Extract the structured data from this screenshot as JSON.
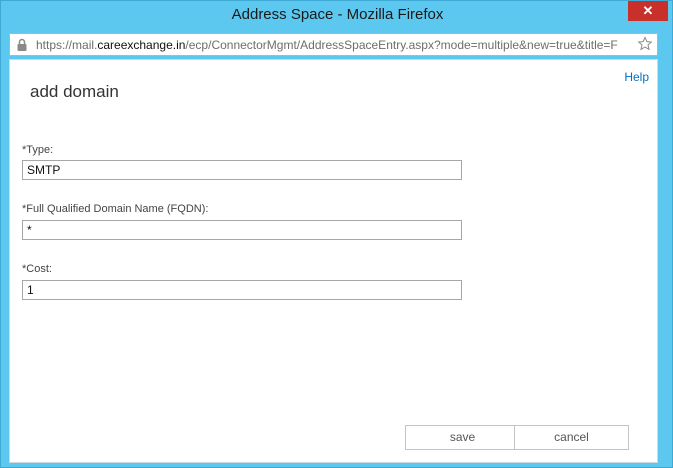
{
  "window": {
    "title": "Address Space - Mozilla Firefox",
    "close_label": "✕"
  },
  "urlbar": {
    "prefix": "https://mail.",
    "host": "careexchange.in",
    "path": "/ecp/ConnectorMgmt/AddressSpaceEntry.aspx?mode=multiple&new=true&title=F",
    "lock_icon": "lock-icon",
    "star_icon": "star-icon"
  },
  "page": {
    "help_label": "Help",
    "heading": "add domain",
    "fields": [
      {
        "label": "*Type:",
        "value": "SMTP"
      },
      {
        "label": "*Full Qualified Domain Name (FQDN):",
        "value": "*"
      },
      {
        "label": "*Cost:",
        "value": "1"
      }
    ],
    "save_label": "save",
    "cancel_label": "cancel"
  },
  "colors": {
    "frame": "#5cc8f0",
    "link": "#0072c6",
    "close": "#c7302b"
  }
}
